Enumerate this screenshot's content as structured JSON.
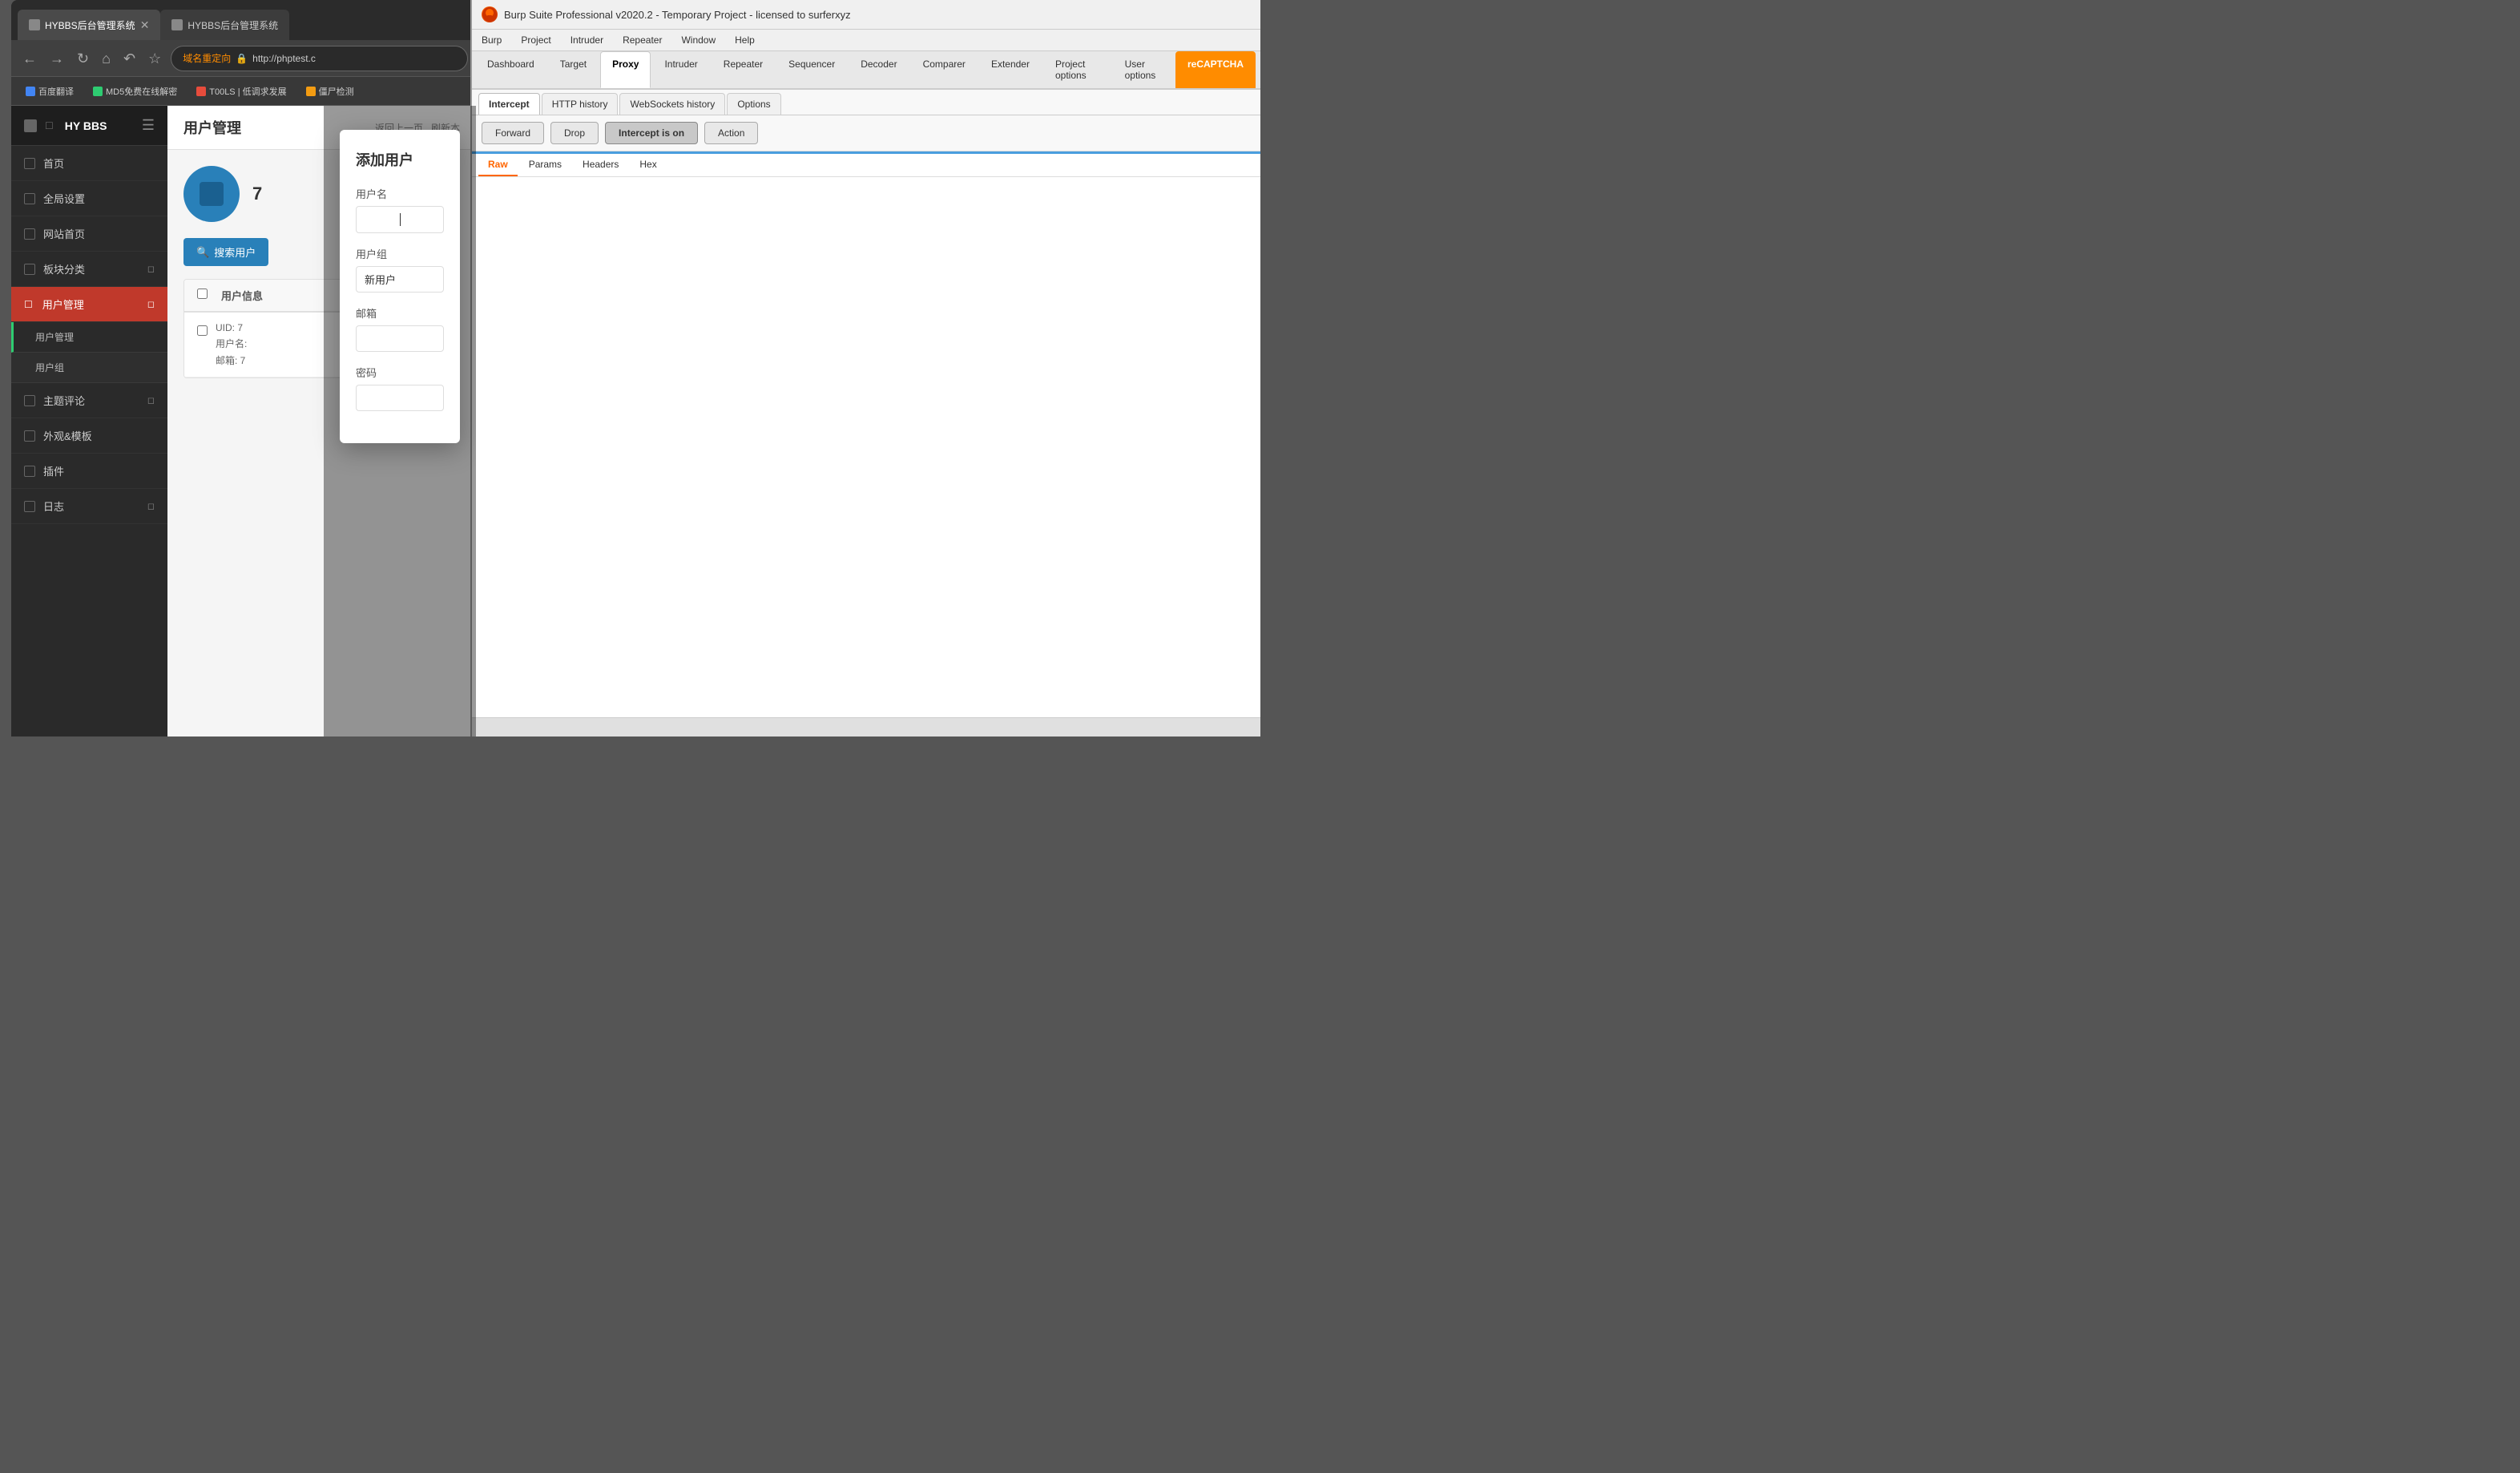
{
  "browser": {
    "tab1": {
      "label": "HYBBS后台管理系统",
      "favicon": "page-icon"
    },
    "tab2": {
      "label": "HYBBS后台管理系统",
      "favicon": "page-icon"
    },
    "address": {
      "redirect_label": "域名重定向",
      "url": "http://phptest.c"
    },
    "bookmarks": [
      {
        "icon": "translate-icon",
        "label": "百度翻译"
      },
      {
        "icon": "hash-icon",
        "label": "MD5免费在线解密"
      },
      {
        "icon": "tool-icon",
        "label": "T00LS | 低调求发展"
      },
      {
        "icon": "zombie-icon",
        "label": "僵尸检测"
      }
    ]
  },
  "cms": {
    "sidebar_title": "HY BBS",
    "nav_items": [
      {
        "label": "首页"
      },
      {
        "label": "全局设置"
      },
      {
        "label": "网站首页"
      },
      {
        "label": "板块分类"
      },
      {
        "label": "用户管理",
        "active": true
      },
      {
        "label": "主题评论"
      },
      {
        "label": "外观&模板"
      },
      {
        "label": "插件"
      },
      {
        "label": "日志"
      }
    ],
    "sub_items": [
      {
        "label": "用户管理",
        "active": true
      },
      {
        "label": "用户组"
      }
    ],
    "page_title": "用户管理",
    "search_btn": "搜索用户",
    "avatar_id": "7",
    "table": {
      "header": "用户信息",
      "rows": [
        {
          "uid": "UID: 7",
          "username": "用户名:",
          "email": "邮箱: 7"
        }
      ]
    }
  },
  "modal": {
    "title": "添加用户",
    "fields": [
      {
        "label": "用户名",
        "placeholder": "",
        "value": ""
      },
      {
        "label": "用户组",
        "placeholder": "新用户",
        "value": "新用户"
      },
      {
        "label": "邮箱",
        "placeholder": "",
        "value": ""
      },
      {
        "label": "密码",
        "placeholder": "",
        "value": ""
      }
    ]
  },
  "burp": {
    "title": "Burp Suite Professional v2020.2 - Temporary Project - licensed to surferxyz",
    "logo_text": "B",
    "menu_items": [
      "Burp",
      "Project",
      "Intruder",
      "Repeater",
      "Window",
      "Help"
    ],
    "primary_tabs": [
      {
        "label": "Dashboard"
      },
      {
        "label": "Target"
      },
      {
        "label": "Proxy",
        "active": true
      },
      {
        "label": "Intruder"
      },
      {
        "label": "Repeater"
      },
      {
        "label": "Sequencer"
      },
      {
        "label": "Decoder"
      },
      {
        "label": "Comparer"
      },
      {
        "label": "Extender"
      },
      {
        "label": "Project options"
      },
      {
        "label": "User options"
      },
      {
        "label": "reCAPTCHA"
      }
    ],
    "secondary_tabs": [
      {
        "label": "Intercept",
        "active": true
      },
      {
        "label": "HTTP history"
      },
      {
        "label": "WebSockets history"
      },
      {
        "label": "Options"
      }
    ],
    "toolbar_btns": [
      {
        "label": "Forward",
        "active": false
      },
      {
        "label": "Drop",
        "active": false
      },
      {
        "label": "Intercept is on",
        "active": true
      },
      {
        "label": "Action",
        "active": false
      }
    ],
    "request_tabs": [
      {
        "label": "Raw",
        "active": true
      },
      {
        "label": "Params"
      },
      {
        "label": "Headers"
      },
      {
        "label": "Hex"
      }
    ]
  }
}
